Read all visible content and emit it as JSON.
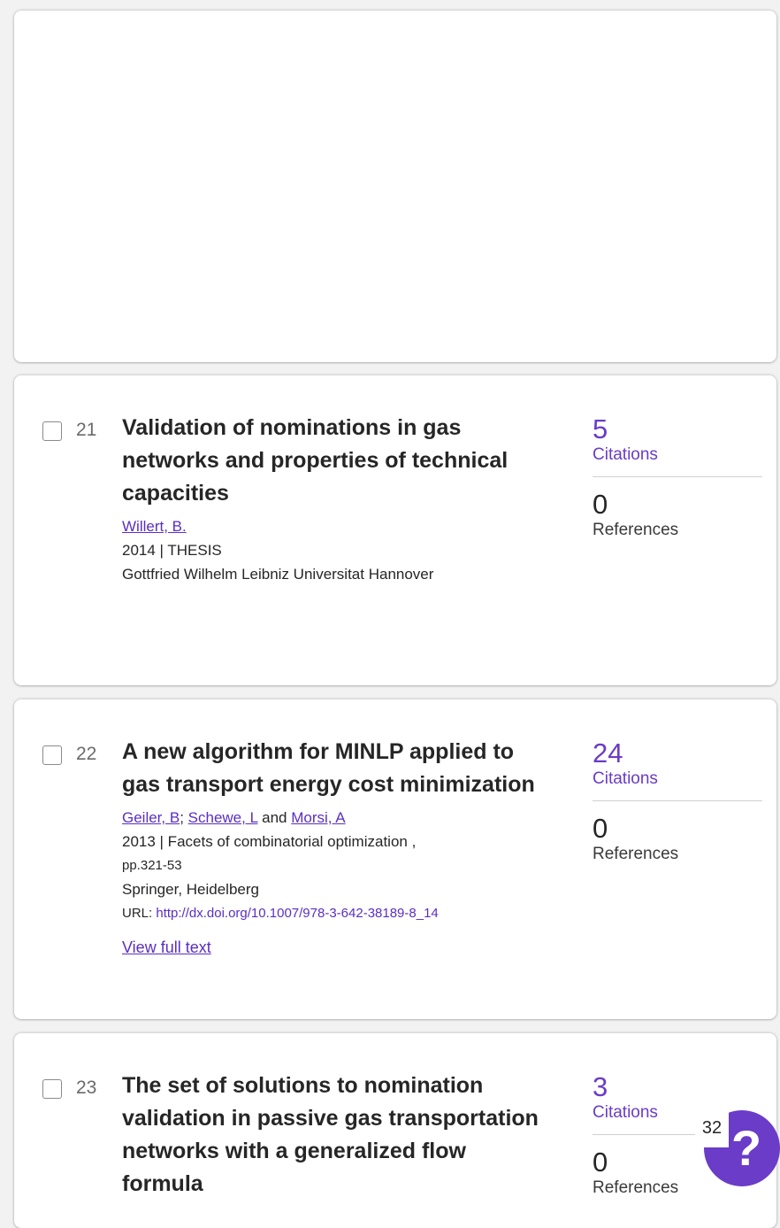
{
  "results": [
    {
      "number": "21",
      "title": "Validation of nominations in gas networks and properties of technical capacities",
      "authors": [
        {
          "name": "Willert, B.",
          "linked": true
        }
      ],
      "year_type": "2014 | THESIS",
      "institution": "Gottfried Wilhelm Leibniz Universitat Hannover",
      "citations_count": "5",
      "citations_label": "Citations",
      "references_count": "0",
      "references_label": "References"
    },
    {
      "number": "22",
      "title": "A new algorithm for MINLP applied to gas transport energy cost minimization",
      "authors": [
        {
          "name": "Geiler, B",
          "linked": true,
          "sep": "; "
        },
        {
          "name": "Schewe, L",
          "linked": true,
          "sep": " and "
        },
        {
          "name": "Morsi, A",
          "linked": true
        }
      ],
      "year_source": "2013 | Facets of combinatorial optimization ,",
      "pages": "pp.321-53",
      "publisher": "Springer, Heidelberg",
      "url_label": "URL:",
      "url": "http://dx.doi.org/10.1007/978-3-642-38189-8_14",
      "full_text_label": "View full text",
      "citations_count": "24",
      "citations_label": "Citations",
      "references_count": "0",
      "references_label": "References"
    },
    {
      "number": "23",
      "title": "The set of solutions to nomination validation in passive gas transportation networks with a generalized flow formula",
      "citations_count": "3",
      "citations_label": "Citations",
      "references_count": "0",
      "references_label": "References"
    }
  ],
  "help_widget": {
    "count": "32",
    "icon": "help-question-icon",
    "glyph": "?"
  },
  "colors": {
    "accent": "#6a3cc8",
    "link": "#5a2fc2"
  }
}
